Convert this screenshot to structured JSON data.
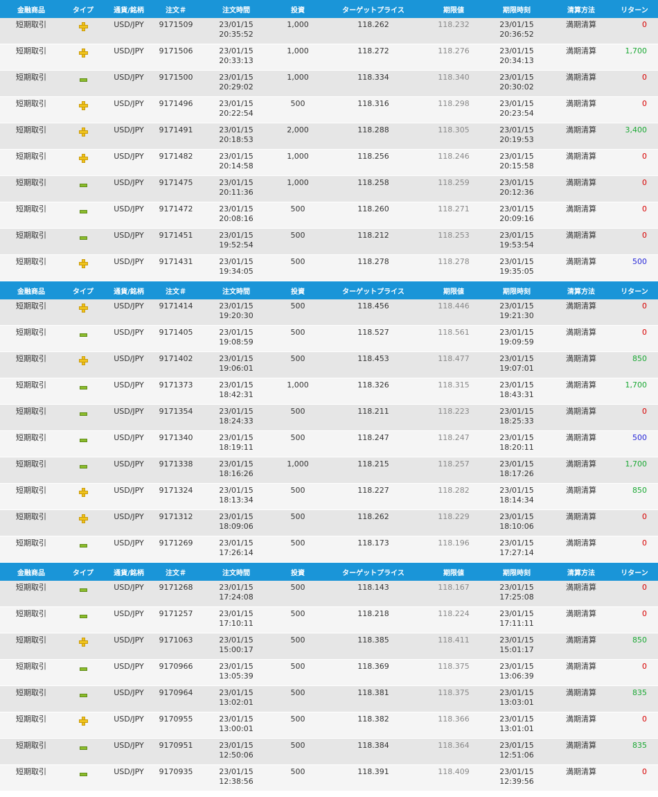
{
  "headers": [
    "金融商品",
    "タイプ",
    "通貨/銘柄",
    "注文＃",
    "注文時間",
    "投資",
    "ターゲットプライス",
    "期限値",
    "期限時刻",
    "清算方法",
    "リターン"
  ],
  "colors": {
    "header": "#1a95d8",
    "plus": "#f0c41d",
    "minus": "#8cbc2c",
    "return_zero": "#d80000",
    "return_win": "#1aa833",
    "return_refund": "#2727d8"
  },
  "icons": {
    "plus": "plus-icon",
    "minus": "minus-icon"
  },
  "sections": [
    {
      "rows": [
        {
          "product": "短期取引",
          "type": "plus",
          "symbol": "USD/JPY",
          "order": "9171509",
          "date": "23/01/15",
          "time": "20:35:52",
          "investment": "1,000",
          "target": "118.262",
          "expiry_value": "118.232",
          "exp_date": "23/01/15",
          "exp_time": "20:36:52",
          "settlement": "満期清算",
          "return": "0",
          "return_type": "zero"
        },
        {
          "product": "短期取引",
          "type": "plus",
          "symbol": "USD/JPY",
          "order": "9171506",
          "date": "23/01/15",
          "time": "20:33:13",
          "investment": "1,000",
          "target": "118.272",
          "expiry_value": "118.276",
          "exp_date": "23/01/15",
          "exp_time": "20:34:13",
          "settlement": "満期清算",
          "return": "1,700",
          "return_type": "win"
        },
        {
          "product": "短期取引",
          "type": "minus",
          "symbol": "USD/JPY",
          "order": "9171500",
          "date": "23/01/15",
          "time": "20:29:02",
          "investment": "1,000",
          "target": "118.334",
          "expiry_value": "118.340",
          "exp_date": "23/01/15",
          "exp_time": "20:30:02",
          "settlement": "満期清算",
          "return": "0",
          "return_type": "zero"
        },
        {
          "product": "短期取引",
          "type": "plus",
          "symbol": "USD/JPY",
          "order": "9171496",
          "date": "23/01/15",
          "time": "20:22:54",
          "investment": "500",
          "target": "118.316",
          "expiry_value": "118.298",
          "exp_date": "23/01/15",
          "exp_time": "20:23:54",
          "settlement": "満期清算",
          "return": "0",
          "return_type": "zero"
        },
        {
          "product": "短期取引",
          "type": "plus",
          "symbol": "USD/JPY",
          "order": "9171491",
          "date": "23/01/15",
          "time": "20:18:53",
          "investment": "2,000",
          "target": "118.288",
          "expiry_value": "118.305",
          "exp_date": "23/01/15",
          "exp_time": "20:19:53",
          "settlement": "満期清算",
          "return": "3,400",
          "return_type": "win"
        },
        {
          "product": "短期取引",
          "type": "plus",
          "symbol": "USD/JPY",
          "order": "9171482",
          "date": "23/01/15",
          "time": "20:14:58",
          "investment": "1,000",
          "target": "118.256",
          "expiry_value": "118.246",
          "exp_date": "23/01/15",
          "exp_time": "20:15:58",
          "settlement": "満期清算",
          "return": "0",
          "return_type": "zero"
        },
        {
          "product": "短期取引",
          "type": "minus",
          "symbol": "USD/JPY",
          "order": "9171475",
          "date": "23/01/15",
          "time": "20:11:36",
          "investment": "1,000",
          "target": "118.258",
          "expiry_value": "118.259",
          "exp_date": "23/01/15",
          "exp_time": "20:12:36",
          "settlement": "満期清算",
          "return": "0",
          "return_type": "zero"
        },
        {
          "product": "短期取引",
          "type": "minus",
          "symbol": "USD/JPY",
          "order": "9171472",
          "date": "23/01/15",
          "time": "20:08:16",
          "investment": "500",
          "target": "118.260",
          "expiry_value": "118.271",
          "exp_date": "23/01/15",
          "exp_time": "20:09:16",
          "settlement": "満期清算",
          "return": "0",
          "return_type": "zero"
        },
        {
          "product": "短期取引",
          "type": "minus",
          "symbol": "USD/JPY",
          "order": "9171451",
          "date": "23/01/15",
          "time": "19:52:54",
          "investment": "500",
          "target": "118.212",
          "expiry_value": "118.253",
          "exp_date": "23/01/15",
          "exp_time": "19:53:54",
          "settlement": "満期清算",
          "return": "0",
          "return_type": "zero"
        },
        {
          "product": "短期取引",
          "type": "plus",
          "symbol": "USD/JPY",
          "order": "9171431",
          "date": "23/01/15",
          "time": "19:34:05",
          "investment": "500",
          "target": "118.278",
          "expiry_value": "118.278",
          "exp_date": "23/01/15",
          "exp_time": "19:35:05",
          "settlement": "満期清算",
          "return": "500",
          "return_type": "refund"
        }
      ]
    },
    {
      "rows": [
        {
          "product": "短期取引",
          "type": "plus",
          "symbol": "USD/JPY",
          "order": "9171414",
          "date": "23/01/15",
          "time": "19:20:30",
          "investment": "500",
          "target": "118.456",
          "expiry_value": "118.446",
          "exp_date": "23/01/15",
          "exp_time": "19:21:30",
          "settlement": "満期清算",
          "return": "0",
          "return_type": "zero"
        },
        {
          "product": "短期取引",
          "type": "minus",
          "symbol": "USD/JPY",
          "order": "9171405",
          "date": "23/01/15",
          "time": "19:08:59",
          "investment": "500",
          "target": "118.527",
          "expiry_value": "118.561",
          "exp_date": "23/01/15",
          "exp_time": "19:09:59",
          "settlement": "満期清算",
          "return": "0",
          "return_type": "zero"
        },
        {
          "product": "短期取引",
          "type": "plus",
          "symbol": "USD/JPY",
          "order": "9171402",
          "date": "23/01/15",
          "time": "19:06:01",
          "investment": "500",
          "target": "118.453",
          "expiry_value": "118.477",
          "exp_date": "23/01/15",
          "exp_time": "19:07:01",
          "settlement": "満期清算",
          "return": "850",
          "return_type": "win"
        },
        {
          "product": "短期取引",
          "type": "minus",
          "symbol": "USD/JPY",
          "order": "9171373",
          "date": "23/01/15",
          "time": "18:42:31",
          "investment": "1,000",
          "target": "118.326",
          "expiry_value": "118.315",
          "exp_date": "23/01/15",
          "exp_time": "18:43:31",
          "settlement": "満期清算",
          "return": "1,700",
          "return_type": "win"
        },
        {
          "product": "短期取引",
          "type": "minus",
          "symbol": "USD/JPY",
          "order": "9171354",
          "date": "23/01/15",
          "time": "18:24:33",
          "investment": "500",
          "target": "118.211",
          "expiry_value": "118.223",
          "exp_date": "23/01/15",
          "exp_time": "18:25:33",
          "settlement": "満期清算",
          "return": "0",
          "return_type": "zero"
        },
        {
          "product": "短期取引",
          "type": "minus",
          "symbol": "USD/JPY",
          "order": "9171340",
          "date": "23/01/15",
          "time": "18:19:11",
          "investment": "500",
          "target": "118.247",
          "expiry_value": "118.247",
          "exp_date": "23/01/15",
          "exp_time": "18:20:11",
          "settlement": "満期清算",
          "return": "500",
          "return_type": "refund"
        },
        {
          "product": "短期取引",
          "type": "minus",
          "symbol": "USD/JPY",
          "order": "9171338",
          "date": "23/01/15",
          "time": "18:16:26",
          "investment": "1,000",
          "target": "118.215",
          "expiry_value": "118.257",
          "exp_date": "23/01/15",
          "exp_time": "18:17:26",
          "settlement": "満期清算",
          "return": "1,700",
          "return_type": "win"
        },
        {
          "product": "短期取引",
          "type": "plus",
          "symbol": "USD/JPY",
          "order": "9171324",
          "date": "23/01/15",
          "time": "18:13:34",
          "investment": "500",
          "target": "118.227",
          "expiry_value": "118.282",
          "exp_date": "23/01/15",
          "exp_time": "18:14:34",
          "settlement": "満期清算",
          "return": "850",
          "return_type": "win"
        },
        {
          "product": "短期取引",
          "type": "plus",
          "symbol": "USD/JPY",
          "order": "9171312",
          "date": "23/01/15",
          "time": "18:09:06",
          "investment": "500",
          "target": "118.262",
          "expiry_value": "118.229",
          "exp_date": "23/01/15",
          "exp_time": "18:10:06",
          "settlement": "満期清算",
          "return": "0",
          "return_type": "zero"
        },
        {
          "product": "短期取引",
          "type": "minus",
          "symbol": "USD/JPY",
          "order": "9171269",
          "date": "23/01/15",
          "time": "17:26:14",
          "investment": "500",
          "target": "118.173",
          "expiry_value": "118.196",
          "exp_date": "23/01/15",
          "exp_time": "17:27:14",
          "settlement": "満期清算",
          "return": "0",
          "return_type": "zero"
        }
      ]
    },
    {
      "rows": [
        {
          "product": "短期取引",
          "type": "minus",
          "symbol": "USD/JPY",
          "order": "9171268",
          "date": "23/01/15",
          "time": "17:24:08",
          "investment": "500",
          "target": "118.143",
          "expiry_value": "118.167",
          "exp_date": "23/01/15",
          "exp_time": "17:25:08",
          "settlement": "満期清算",
          "return": "0",
          "return_type": "zero"
        },
        {
          "product": "短期取引",
          "type": "minus",
          "symbol": "USD/JPY",
          "order": "9171257",
          "date": "23/01/15",
          "time": "17:10:11",
          "investment": "500",
          "target": "118.218",
          "expiry_value": "118.224",
          "exp_date": "23/01/15",
          "exp_time": "17:11:11",
          "settlement": "満期清算",
          "return": "0",
          "return_type": "zero"
        },
        {
          "product": "短期取引",
          "type": "plus",
          "symbol": "USD/JPY",
          "order": "9171063",
          "date": "23/01/15",
          "time": "15:00:17",
          "investment": "500",
          "target": "118.385",
          "expiry_value": "118.411",
          "exp_date": "23/01/15",
          "exp_time": "15:01:17",
          "settlement": "満期清算",
          "return": "850",
          "return_type": "win"
        },
        {
          "product": "短期取引",
          "type": "minus",
          "symbol": "USD/JPY",
          "order": "9170966",
          "date": "23/01/15",
          "time": "13:05:39",
          "investment": "500",
          "target": "118.369",
          "expiry_value": "118.375",
          "exp_date": "23/01/15",
          "exp_time": "13:06:39",
          "settlement": "満期清算",
          "return": "0",
          "return_type": "zero"
        },
        {
          "product": "短期取引",
          "type": "minus",
          "symbol": "USD/JPY",
          "order": "9170964",
          "date": "23/01/15",
          "time": "13:02:01",
          "investment": "500",
          "target": "118.381",
          "expiry_value": "118.375",
          "exp_date": "23/01/15",
          "exp_time": "13:03:01",
          "settlement": "満期清算",
          "return": "835",
          "return_type": "win"
        },
        {
          "product": "短期取引",
          "type": "plus",
          "symbol": "USD/JPY",
          "order": "9170955",
          "date": "23/01/15",
          "time": "13:00:01",
          "investment": "500",
          "target": "118.382",
          "expiry_value": "118.366",
          "exp_date": "23/01/15",
          "exp_time": "13:01:01",
          "settlement": "満期清算",
          "return": "0",
          "return_type": "zero"
        },
        {
          "product": "短期取引",
          "type": "minus",
          "symbol": "USD/JPY",
          "order": "9170951",
          "date": "23/01/15",
          "time": "12:50:06",
          "investment": "500",
          "target": "118.384",
          "expiry_value": "118.364",
          "exp_date": "23/01/15",
          "exp_time": "12:51:06",
          "settlement": "満期清算",
          "return": "835",
          "return_type": "win"
        },
        {
          "product": "短期取引",
          "type": "minus",
          "symbol": "USD/JPY",
          "order": "9170935",
          "date": "23/01/15",
          "time": "12:38:56",
          "investment": "500",
          "target": "118.391",
          "expiry_value": "118.409",
          "exp_date": "23/01/15",
          "exp_time": "12:39:56",
          "settlement": "満期清算",
          "return": "0",
          "return_type": "zero"
        }
      ]
    }
  ]
}
